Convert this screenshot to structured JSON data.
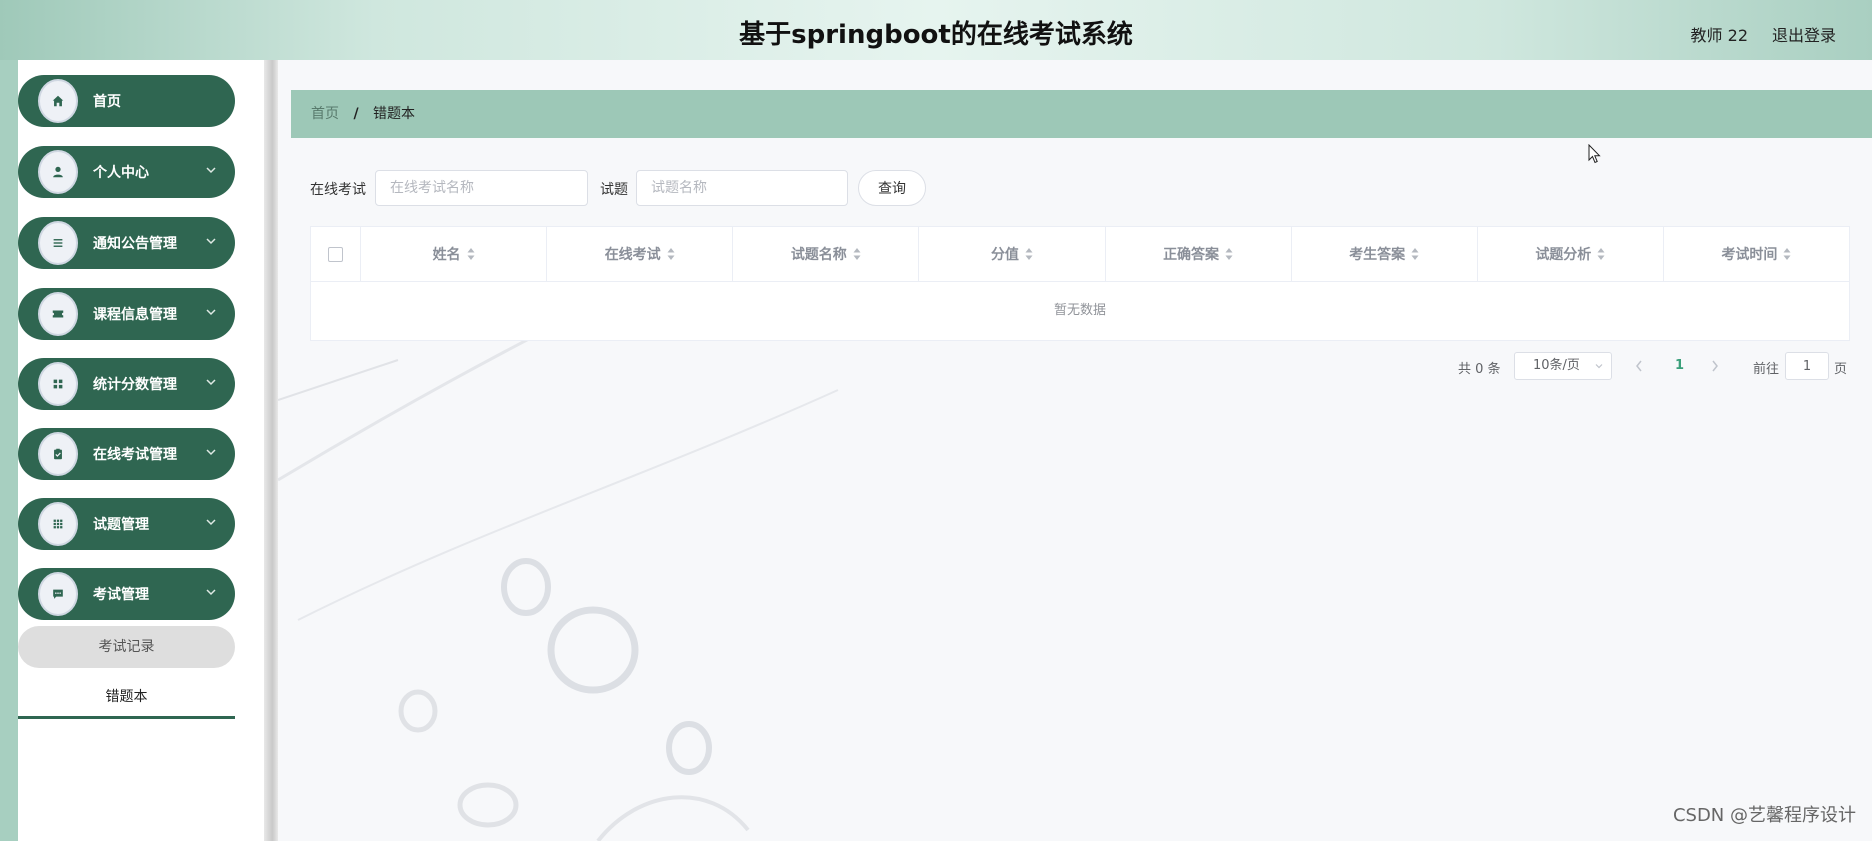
{
  "header": {
    "title": "基于springboot的在线考试系统",
    "user": "教师 22",
    "logout": "退出登录"
  },
  "sidebar": {
    "items": [
      {
        "label": "首页",
        "icon": "home-icon",
        "has_children": false
      },
      {
        "label": "个人中心",
        "icon": "user-icon",
        "has_children": true
      },
      {
        "label": "通知公告管理",
        "icon": "list-icon",
        "has_children": true
      },
      {
        "label": "课程信息管理",
        "icon": "ticket-icon",
        "has_children": true
      },
      {
        "label": "统计分数管理",
        "icon": "grid-icon",
        "has_children": true
      },
      {
        "label": "在线考试管理",
        "icon": "clipboard-check-icon",
        "has_children": true
      },
      {
        "label": "试题管理",
        "icon": "apps-icon",
        "has_children": true
      },
      {
        "label": "考试管理",
        "icon": "message-icon",
        "has_children": true
      }
    ],
    "sub_items": [
      {
        "label": "考试记录",
        "state": "hover"
      },
      {
        "label": "错题本",
        "state": "active"
      }
    ]
  },
  "breadcrumb": {
    "home": "首页",
    "separator": "/",
    "current": "错题本"
  },
  "search": {
    "exam_label": "在线考试",
    "exam_placeholder": "在线考试名称",
    "exam_value": "",
    "question_label": "试题",
    "question_placeholder": "试题名称",
    "question_value": "",
    "query_button": "查询"
  },
  "table": {
    "columns": [
      "姓名",
      "在线考试",
      "试题名称",
      "分值",
      "正确答案",
      "考生答案",
      "试题分析",
      "考试时间"
    ],
    "rows": [],
    "empty_text": "暂无数据"
  },
  "pagination": {
    "total": "共 0 条",
    "page_size": "10条/页",
    "current_page": "1",
    "goto_prefix": "前往",
    "goto_value": "1",
    "goto_suffix": "页"
  },
  "watermark": "CSDN @艺馨程序设计",
  "colors": {
    "sidebar_item_bg": "#2f6651",
    "breadcrumb_bg": "#9dc8b7",
    "active_page": "#3a9f7a",
    "left_stripe": "#a7cfc0"
  }
}
